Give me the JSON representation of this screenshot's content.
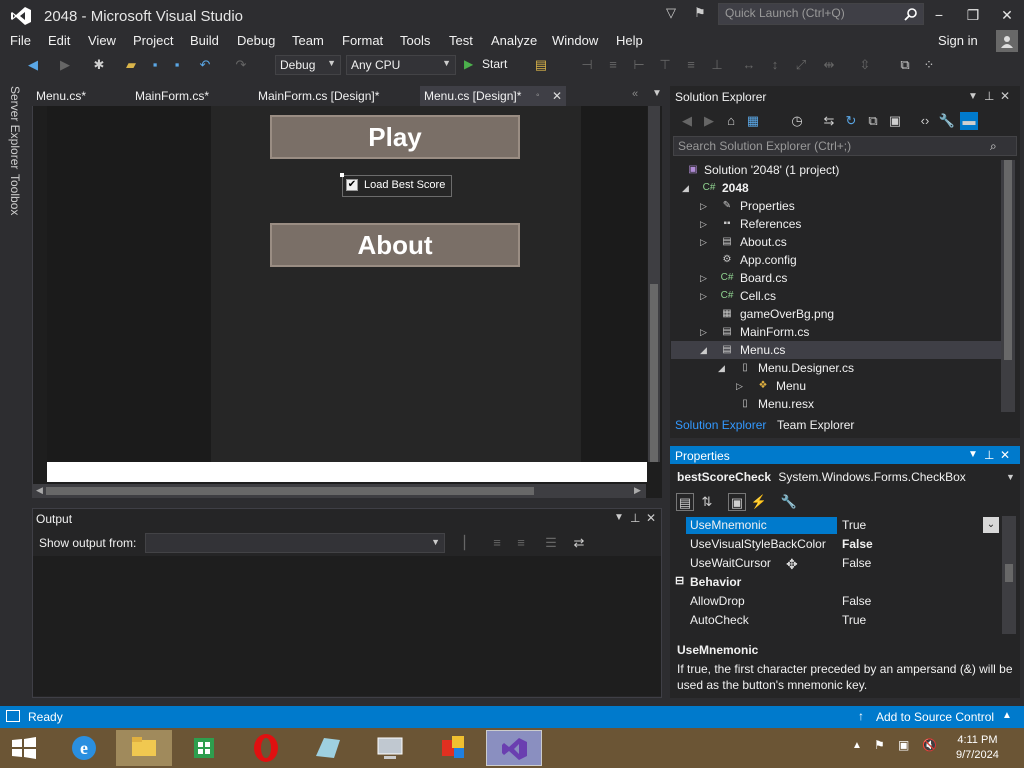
{
  "window": {
    "title": "2048 - Microsoft Visual Studio",
    "quick_launch_placeholder": "Quick Launch (Ctrl+Q)",
    "minimize": "−",
    "restore": "❐",
    "close": "✕"
  },
  "menu": {
    "items": [
      "File",
      "Edit",
      "View",
      "Project",
      "Build",
      "Debug",
      "Team",
      "Format",
      "Tools",
      "Test",
      "Analyze",
      "Window",
      "Help"
    ],
    "signin": "Sign in"
  },
  "toolbar": {
    "config": "Debug",
    "platform": "Any CPU",
    "start": "Start"
  },
  "left_tabs": [
    "Server Explorer",
    "Toolbox"
  ],
  "doc_tabs": [
    {
      "label": "Menu.cs*"
    },
    {
      "label": "MainForm.cs*"
    },
    {
      "label": "MainForm.cs [Design]*"
    },
    {
      "label": "Menu.cs [Design]*"
    }
  ],
  "designer": {
    "play_button": "Play",
    "about_button": "About",
    "checkbox_label": "Load Best Score",
    "checkbox_checked": true
  },
  "output": {
    "title": "Output",
    "show_from": "Show output from:"
  },
  "solution_explorer": {
    "title": "Solution Explorer",
    "search_placeholder": "Search Solution Explorer (Ctrl+;)",
    "items": [
      "Solution '2048' (1 project)",
      "2048",
      "Properties",
      "References",
      "About.cs",
      "App.config",
      "Board.cs",
      "Cell.cs",
      "gameOverBg.png",
      "MainForm.cs",
      "Menu.cs",
      "Menu.Designer.cs",
      "Menu",
      "Menu.resx"
    ],
    "bottom_tabs": [
      "Solution Explorer",
      "Team Explorer"
    ]
  },
  "properties": {
    "title": "Properties",
    "object_name": "bestScoreCheck",
    "object_type": "System.Windows.Forms.CheckBox",
    "rows": [
      {
        "name": "UseMnemonic",
        "value": "True"
      },
      {
        "name": "UseVisualStyleBackColor",
        "value": "False"
      },
      {
        "name": "UseWaitCursor",
        "value": "False"
      },
      {
        "name": "Behavior",
        "value": ""
      },
      {
        "name": "AllowDrop",
        "value": "False"
      },
      {
        "name": "AutoCheck",
        "value": "True"
      }
    ],
    "desc_title": "UseMnemonic",
    "desc_text": "If true, the first character preceded by an ampersand (&) will be used as the button's mnemonic key."
  },
  "status": {
    "text": "Ready",
    "source_control": "Add to Source Control"
  },
  "taskbar": {
    "time": "4:11 PM",
    "date": "9/7/2024"
  },
  "colors": {
    "accent": "#007acc",
    "chrome": "#2d2d30",
    "button_face": "#7a6f67"
  }
}
